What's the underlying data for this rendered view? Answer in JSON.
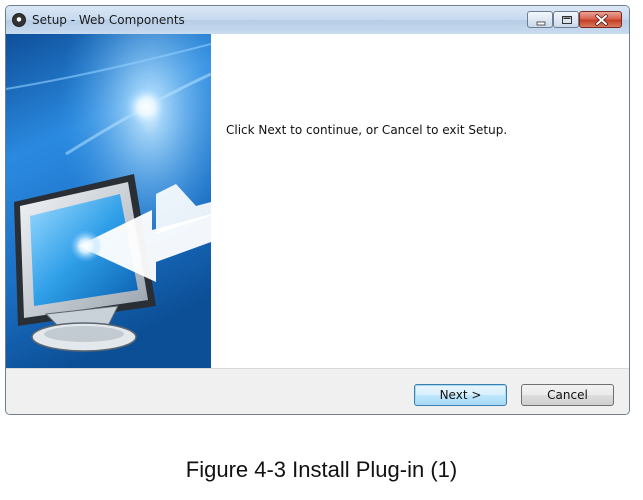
{
  "window": {
    "title": "Setup - Web Components"
  },
  "main": {
    "message": "Click Next to continue, or Cancel to exit Setup."
  },
  "footer": {
    "next_label": "Next >",
    "cancel_label": "Cancel"
  },
  "caption": "Figure 4-3 Install Plug-in (1)",
  "icons": {
    "app": "setup-app-icon",
    "minimize": "minimize-icon",
    "maximize": "maximize-icon",
    "close": "close-icon",
    "banner": "monitor-install-arrow-graphic"
  },
  "colors": {
    "titlebar": "#c6d9ee",
    "banner_blue": "#1e73c8",
    "close_red": "#c63f27",
    "default_button": "#3c7fb1"
  }
}
